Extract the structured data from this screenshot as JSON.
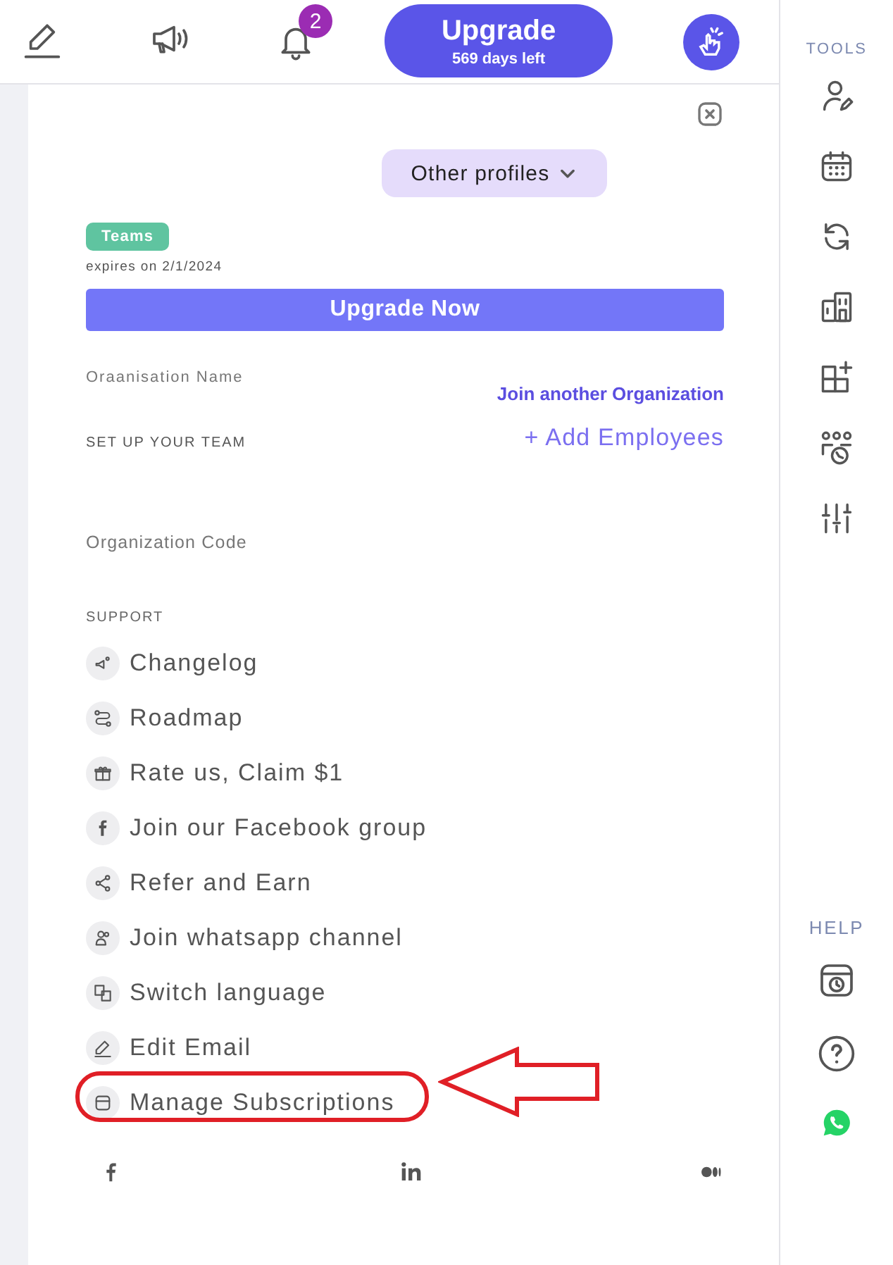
{
  "topbar": {
    "notification_count": "2",
    "upgrade": {
      "title": "Upgrade",
      "subtitle": "569 days left"
    }
  },
  "panel": {
    "profiles_button": "Other profiles",
    "plan_badge": "Teams",
    "expiry": "expires on 2/1/2024",
    "upgrade_button": "Upgrade Now",
    "org_name_label": "Oraanisation Name",
    "join_link": "Join another Organization",
    "team_label": "SET UP YOUR TEAM",
    "add_employees": "+ Add Employees",
    "org_code_label": "Organization Code",
    "support_heading": "SUPPORT",
    "support_items": [
      {
        "label": "Changelog",
        "highlighted": false
      },
      {
        "label": "Roadmap",
        "highlighted": false
      },
      {
        "label": "Rate us, Claim $1",
        "highlighted": false
      },
      {
        "label": "Join our Facebook group",
        "highlighted": false
      },
      {
        "label": "Refer and Earn",
        "highlighted": false
      },
      {
        "label": "Join whatsapp channel",
        "highlighted": false
      },
      {
        "label": "Switch language",
        "highlighted": false
      },
      {
        "label": "Edit Email",
        "highlighted": false
      },
      {
        "label": "Manage Subscriptions",
        "highlighted": true
      }
    ]
  },
  "sidebar": {
    "tools_heading": "TOOLS",
    "help_heading": "HELP"
  }
}
